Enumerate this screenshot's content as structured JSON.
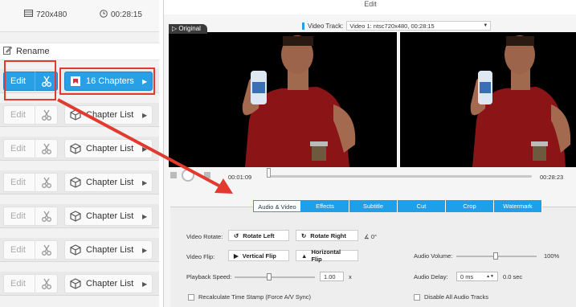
{
  "left": {
    "resolution": "720x480",
    "duration": "00:28:15",
    "rename_label": "Rename",
    "rows": [
      {
        "edit": "Edit",
        "chapter": "16 Chapters",
        "active": true
      },
      {
        "edit": "Edit",
        "chapter": "Chapter List",
        "active": false
      },
      {
        "edit": "Edit",
        "chapter": "Chapter List",
        "active": false
      },
      {
        "edit": "Edit",
        "chapter": "Chapter List",
        "active": false
      },
      {
        "edit": "Edit",
        "chapter": "Chapter List",
        "active": false
      },
      {
        "edit": "Edit",
        "chapter": "Chapter List",
        "active": false
      },
      {
        "edit": "Edit",
        "chapter": "Chapter List",
        "active": false
      }
    ]
  },
  "right": {
    "title": "Edit",
    "video_track_label": "Video Track:",
    "video_track_value": "Video 1: ntsc720x480, 00:28:15",
    "original_badge": "Original",
    "time_current": "00:01:09",
    "time_total": "00:28:23",
    "tabs": [
      "Audio & Video",
      "Effects",
      "Subtitle",
      "Cut",
      "Crop",
      "Watermark"
    ],
    "active_tab": "Audio & Video",
    "video_rotate_label": "Video Rotate:",
    "rotate_left": "Rotate Left",
    "rotate_right": "Rotate Right",
    "angle": "0°",
    "video_flip_label": "Video Flip:",
    "vertical_flip": "Vertical Flip",
    "horizontal_flip": "Horizontal Flip",
    "playback_speed_label": "Playback Speed:",
    "playback_speed_value": "1.00",
    "speed_unit": "x",
    "audio_volume_label": "Audio Volume:",
    "audio_volume_value": "100%",
    "audio_delay_label": "Audio Delay:",
    "audio_delay_value": "0 ms",
    "audio_delay_sec": "0.0 sec",
    "recalc_label": "Recalculate Time Stamp (Force A/V Sync)",
    "disable_audio_label": "Disable All Audio Tracks"
  },
  "colors": {
    "accent": "#29a0e6",
    "highlight": "#e23a2e"
  }
}
